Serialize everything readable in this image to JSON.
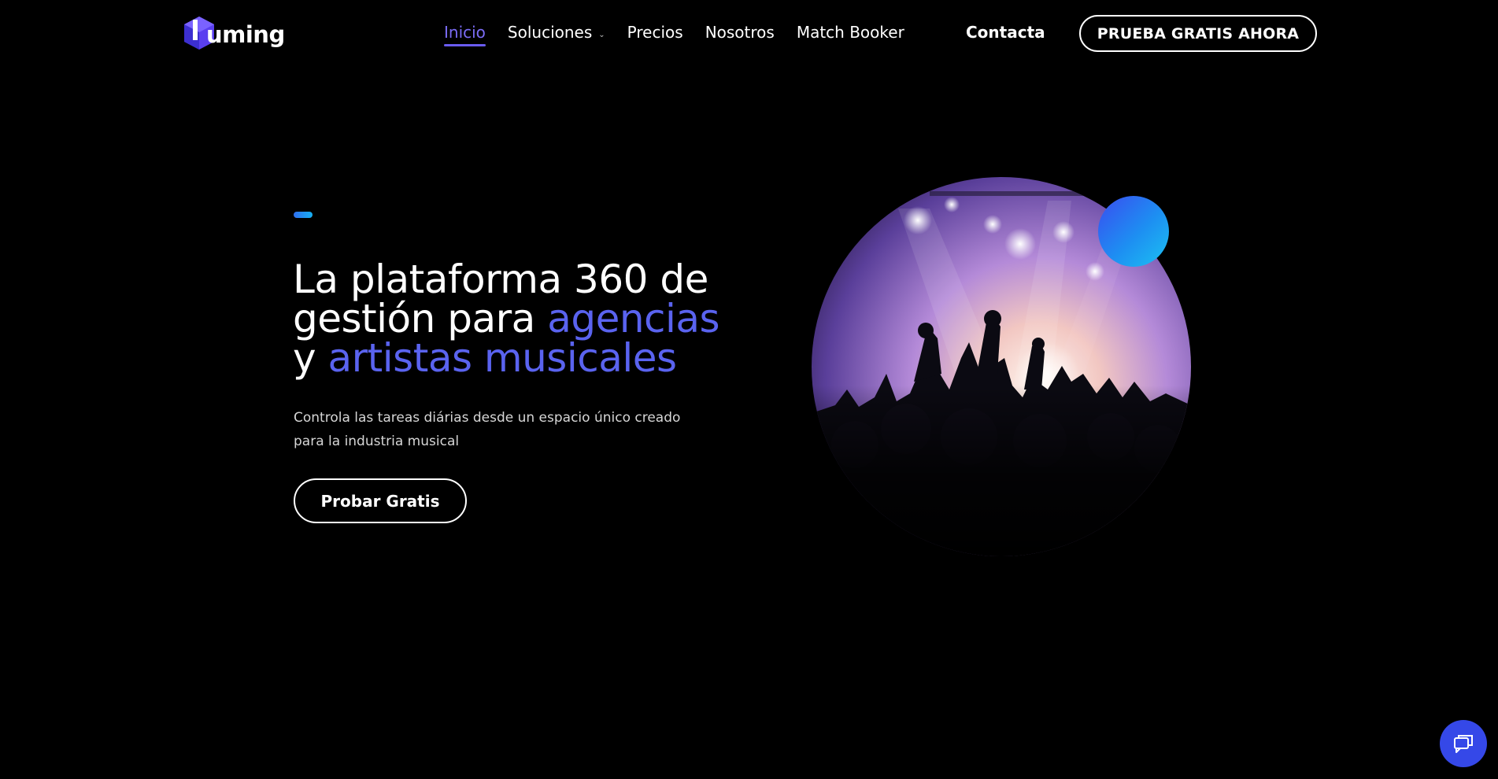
{
  "header": {
    "logo_text": "uming",
    "nav": [
      {
        "label": "Inicio",
        "active": true
      },
      {
        "label": "Soluciones",
        "has_dropdown": true
      },
      {
        "label": "Precios"
      },
      {
        "label": "Nosotros"
      },
      {
        "label": "Match Booker"
      }
    ],
    "contact_label": "Contacta",
    "cta_label": "PRUEBA GRATIS AHORA"
  },
  "hero": {
    "title_line1": "La plataforma 360 de",
    "title_line2_plain": "gestión para ",
    "title_line2_highlight": "agencias",
    "title_line3_plain": "y ",
    "title_line3_highlight": "artistas musicales",
    "subtitle": "Controla las tareas diárias desde un espacio único creado para la industria musical",
    "cta_label": "Probar Gratis"
  },
  "icons": {
    "logo": "cube-logo-icon",
    "dropdown": "chevron-down-icon",
    "chat": "chat-icon"
  },
  "colors": {
    "background": "#000000",
    "accent": "#5a63ef",
    "active_nav": "#7b6cf6",
    "chat_button": "#3548e8"
  }
}
